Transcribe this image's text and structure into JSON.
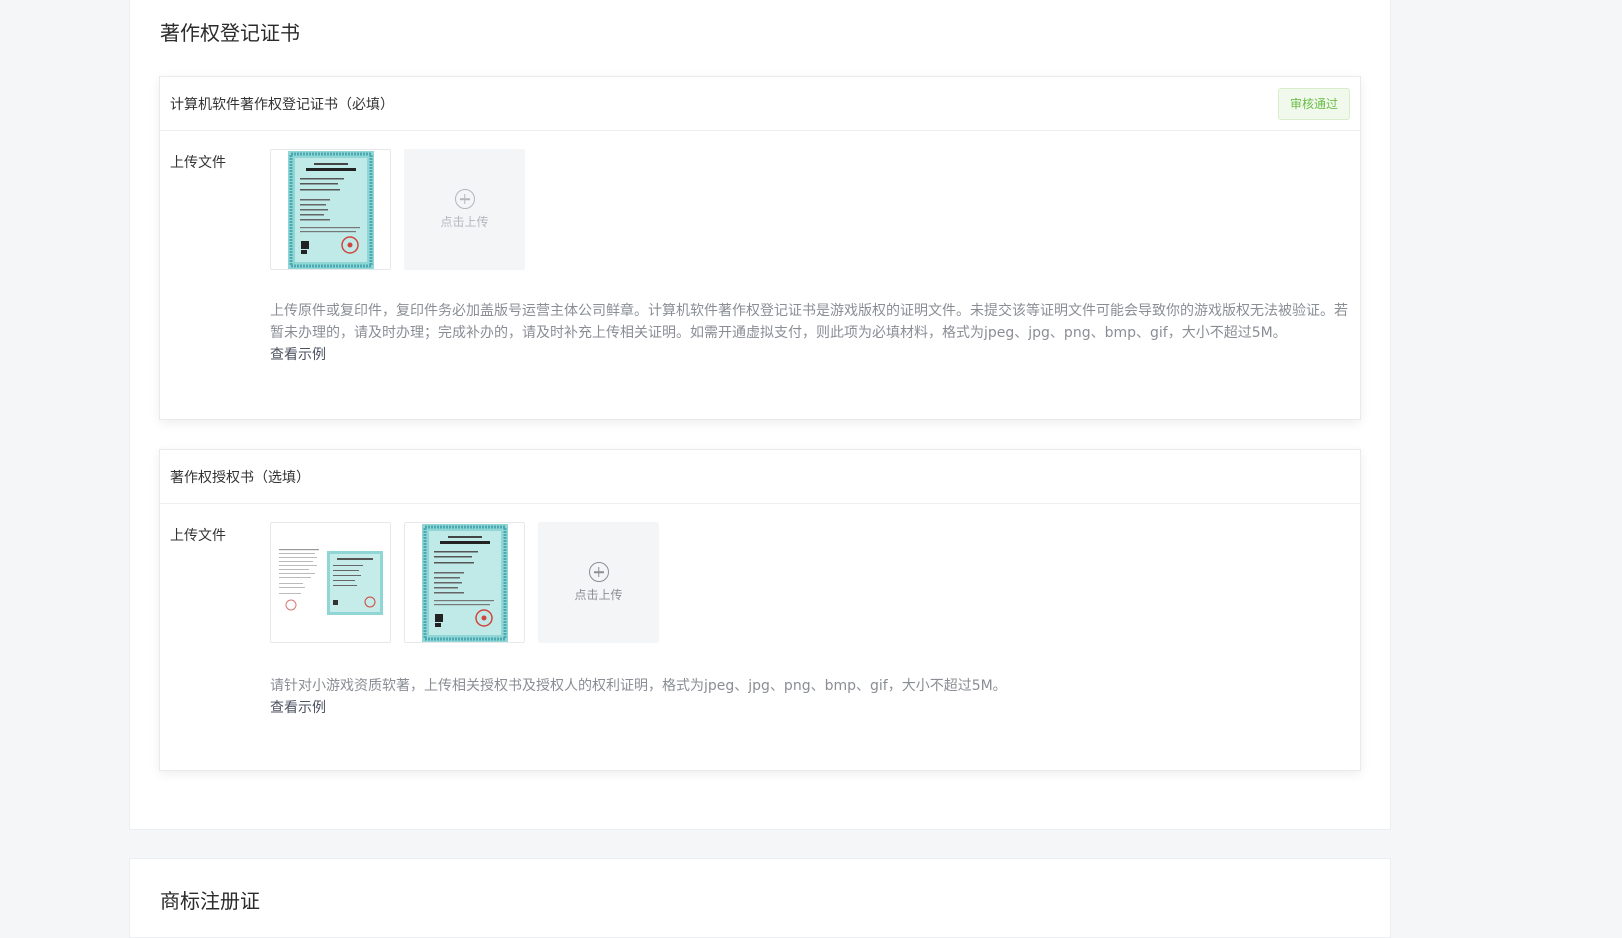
{
  "copyright_section": {
    "title": "著作权登记证书",
    "certificate_card": {
      "title": "计算机软件著作权登记证书（必填）",
      "status_badge": "审核通过",
      "upload_label": "上传文件",
      "upload_button": "点击上传",
      "hint": "上传原件或复印件，复印件务必加盖版号运营主体公司鲜章。计算机软件著作权登记证书是游戏版权的证明文件。未提交该等证明文件可能会导致你的游戏版权无法被验证。若暂未办理的，请及时办理；完成补办的，请及时补充上传相关证明。如需开通虚拟支付，则此项为必填材料，格式为jpeg、jpg、png、bmp、gif，大小不超过5M。",
      "example_link": "查看示例"
    },
    "authorization_card": {
      "title": "著作权授权书（选填）",
      "upload_label": "上传文件",
      "upload_button": "点击上传",
      "hint": "请针对小游戏资质软著，上传相关授权书及授权人的权利证明，格式为jpeg、jpg、png、bmp、gif，大小不超过5M。",
      "example_link": "查看示例"
    }
  },
  "trademark_section": {
    "title": "商标注册证"
  },
  "colors": {
    "status_success": "#6cbd47",
    "certificate_teal": "#8fd6d4"
  },
  "icons": [
    "plus-circle-icon",
    "certificate-thumbnail"
  ]
}
